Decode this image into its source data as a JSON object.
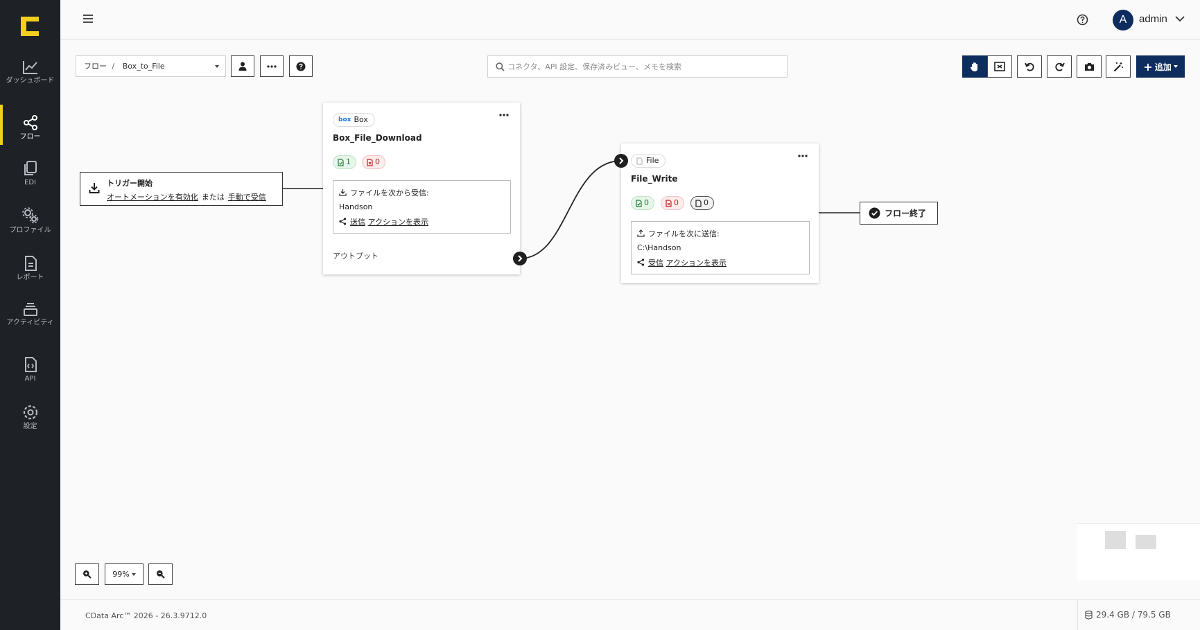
{
  "sidebar": {
    "items": [
      {
        "label": "ダッシュボード",
        "icon": "chart-line-icon"
      },
      {
        "label": "フロー",
        "icon": "share-nodes-icon",
        "active": true
      },
      {
        "label": "EDI",
        "icon": "documents-icon"
      },
      {
        "label": "プロファイル",
        "icon": "gears-icon"
      },
      {
        "label": "レポート",
        "icon": "report-icon"
      },
      {
        "label": "アクティビティ",
        "icon": "layers-icon"
      },
      {
        "label": "API",
        "icon": "code-file-icon"
      },
      {
        "label": "設定",
        "icon": "gear-icon"
      }
    ]
  },
  "header": {
    "avatar_initial": "A",
    "user_name": "admin"
  },
  "toolbar": {
    "breadcrumb_root": "フロー",
    "breadcrumb_sep": "/",
    "breadcrumb_current": "Box_to_File",
    "search_placeholder": "コネクタ、API 設定、保存済みビュー、メモを検索",
    "add_label": "追加"
  },
  "canvas": {
    "trigger": {
      "title": "トリガー開始",
      "enable_link": "オートメーションを有効化",
      "or_text": "または",
      "manual_link": "手動で受信"
    },
    "nodes": [
      {
        "connector": "Box",
        "brand_mark": "box",
        "name": "Box_File_Download",
        "success_count": "1",
        "error_count": "0",
        "direction_label": "ファイルを次から受信:",
        "path": "Handson",
        "action_link_1": "送信",
        "action_link_2": "アクションを表示",
        "output_label": "アウトプット"
      },
      {
        "connector": "File",
        "name": "File_Write",
        "success_count": "0",
        "error_count": "0",
        "pending_count": "0",
        "direction_label": "ファイルを次に送信:",
        "path": "C:\\Handson",
        "action_link_1": "受信",
        "action_link_2": "アクションを表示"
      }
    ],
    "end": {
      "label": "フロー終了"
    }
  },
  "zoom": {
    "level": "99%"
  },
  "footer": {
    "version": "CData Arc™ 2026 - 26.3.9712.0",
    "storage": "29.4 GB / 79.5 GB"
  },
  "colors": {
    "sidebar_bg": "#1e2126",
    "accent_yellow": "#f2cf1a",
    "primary_navy": "#0d2d5e"
  }
}
